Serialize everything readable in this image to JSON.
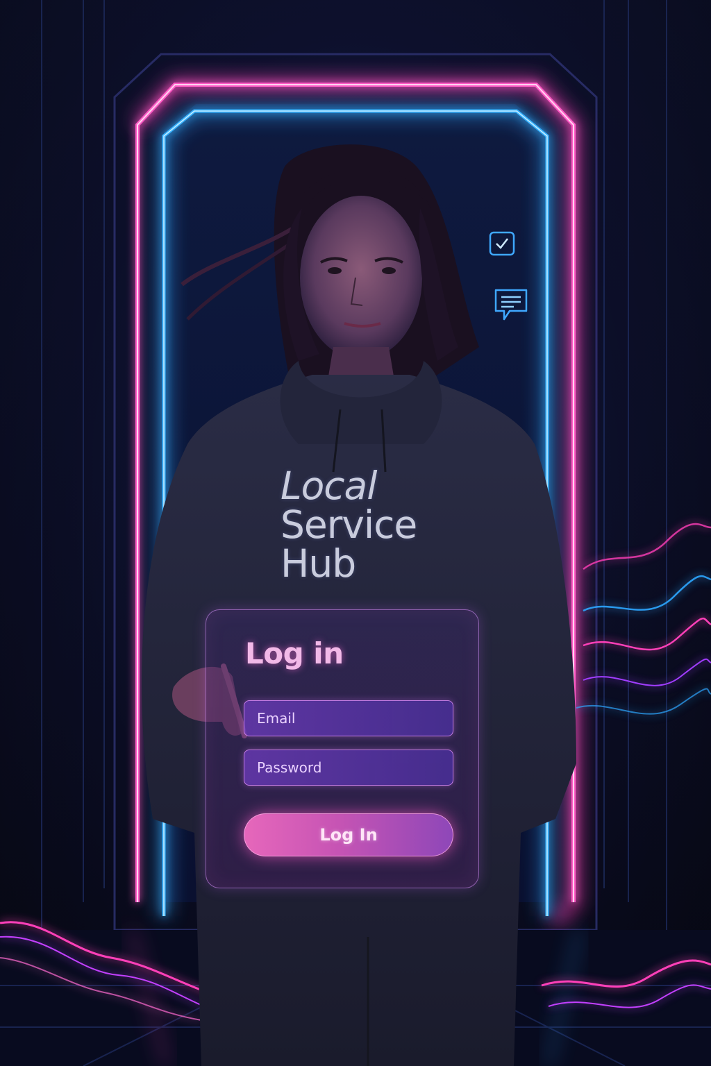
{
  "brand": {
    "line1": "Local",
    "line2": "Service",
    "line3": "Hub"
  },
  "login": {
    "title": "Log in",
    "email_placeholder": "Email",
    "password_placeholder": "Password",
    "submit_label": "Log In"
  },
  "icons": {
    "checklist": "checkbox-icon",
    "chat": "chat-bubble-icon"
  },
  "colors": {
    "neon_pink": "#ff3fb8",
    "neon_blue": "#2ea6ff",
    "button_gradient_start": "#e667bb",
    "button_gradient_end": "#8e47b8"
  }
}
